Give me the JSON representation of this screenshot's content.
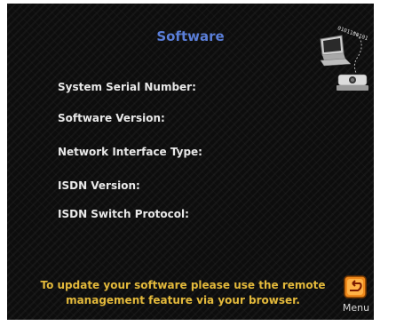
{
  "title": "Software",
  "fields": [
    {
      "label": "System Serial Number:"
    },
    {
      "label": "Software Version:"
    },
    {
      "label": "Network Interface Type:"
    },
    {
      "label": "ISDN Version:"
    },
    {
      "label": "ISDN Switch Protocol:"
    }
  ],
  "footer": {
    "line1": "To update your software please use the remote",
    "line2": "management feature via your browser."
  },
  "menu_button": {
    "label": "Menu",
    "icon": "back-arrow-icon"
  },
  "colors": {
    "title": "#5a7ed8",
    "footer_text": "#e3b93b",
    "menu_icon": "#f08a1c"
  },
  "decor": {
    "icon": "computer-camera-icon",
    "binary_text": "0101100101"
  }
}
